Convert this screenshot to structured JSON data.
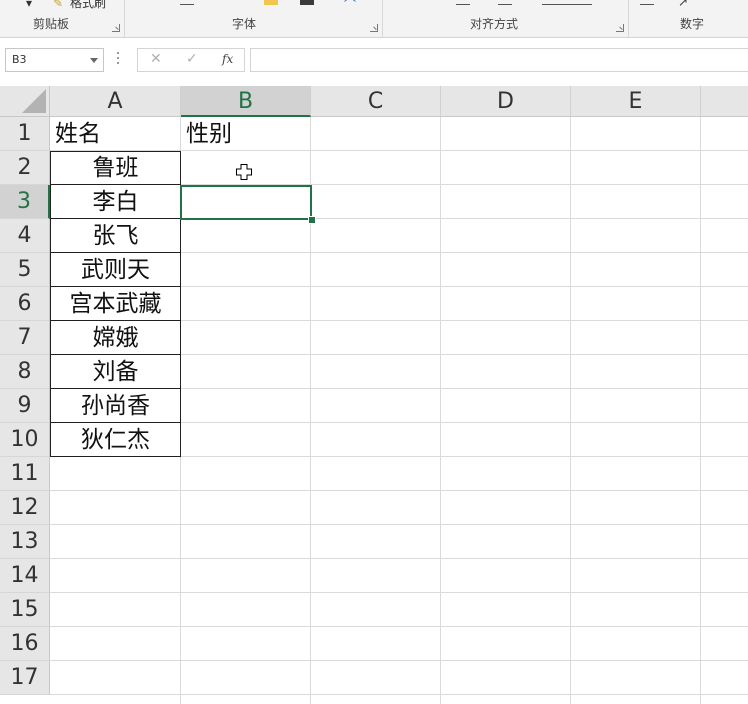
{
  "ribbon": {
    "top_fragments": {
      "format_painter": "格式刷"
    },
    "groups": [
      {
        "name": "clipboard",
        "label": "剪贴板"
      },
      {
        "name": "font",
        "label": "字体"
      },
      {
        "name": "alignment",
        "label": "对齐方式"
      },
      {
        "name": "number",
        "label": "数字"
      }
    ]
  },
  "formula_bar": {
    "name_box": "B3",
    "cancel_icon": "✕",
    "enter_icon": "✓",
    "fx_label": "fx",
    "formula": ""
  },
  "sheet": {
    "columns": [
      "A",
      "B",
      "C",
      "D",
      "E"
    ],
    "rows": [
      "1",
      "2",
      "3",
      "4",
      "5",
      "6",
      "7",
      "8",
      "9",
      "10",
      "11",
      "12",
      "13",
      "14",
      "15",
      "16",
      "17"
    ],
    "selected_cell": "B3",
    "cells": {
      "A1": "姓名",
      "B1": "性别",
      "A2": "鲁班",
      "A3": "李白",
      "A4": "张飞",
      "A5": "武则天",
      "A6": "宫本武藏",
      "A7": "嫦娥",
      "A8": "刘备",
      "A9": "孙尚香",
      "A10": "狄仁杰"
    }
  },
  "colors": {
    "accent": "#217346",
    "header_bg": "#e6e6e6",
    "gridline": "#dadada"
  }
}
